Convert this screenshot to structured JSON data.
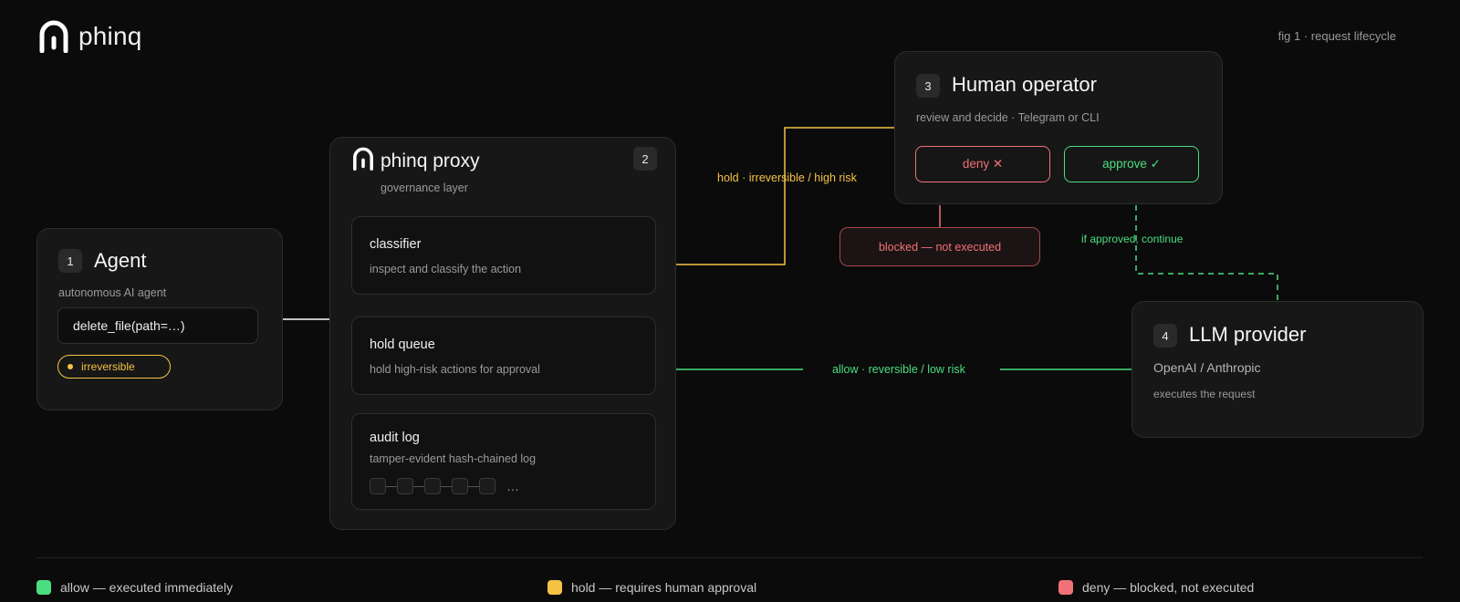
{
  "header": {
    "brand": "phinq",
    "fig_label": "fig 1 · request lifecycle"
  },
  "agent": {
    "badge": "1",
    "title": "Agent",
    "subtitle": "autonomous AI agent",
    "call": "delete_file(path=…)",
    "tag": "irreversible"
  },
  "proxy": {
    "badge": "2",
    "title": "phinq proxy",
    "subtitle": "governance layer",
    "stages": [
      {
        "title": "classifier",
        "desc": "inspect and classify the action"
      },
      {
        "title": "hold queue",
        "desc": "hold high-risk actions for approval"
      },
      {
        "title": "audit log",
        "desc": "tamper-evident hash-chained log"
      }
    ],
    "chain_more": "…"
  },
  "operator": {
    "badge": "3",
    "title": "Human operator",
    "subtitle": "review and decide · Telegram or CLI",
    "deny_label": "deny ✕",
    "approve_label": "approve ✓",
    "blocked_label": "blocked — not executed"
  },
  "llm": {
    "badge": "4",
    "title": "LLM provider",
    "subtitle": "OpenAI / Anthropic",
    "desc": "executes the request"
  },
  "edges": {
    "hold_label": "hold · irreversible / high risk",
    "allow_label": "allow · reversible / low risk",
    "approved_label": "if approved, continue"
  },
  "legend": [
    {
      "label": "allow — executed immediately",
      "color": "#4ade80"
    },
    {
      "label": "hold — requires human approval",
      "color": "#f6c244"
    },
    {
      "label": "deny — blocked, not executed",
      "color": "#f07178"
    }
  ],
  "colors": {
    "allow": "#4ade80",
    "hold": "#f6c244",
    "deny": "#f07178"
  }
}
